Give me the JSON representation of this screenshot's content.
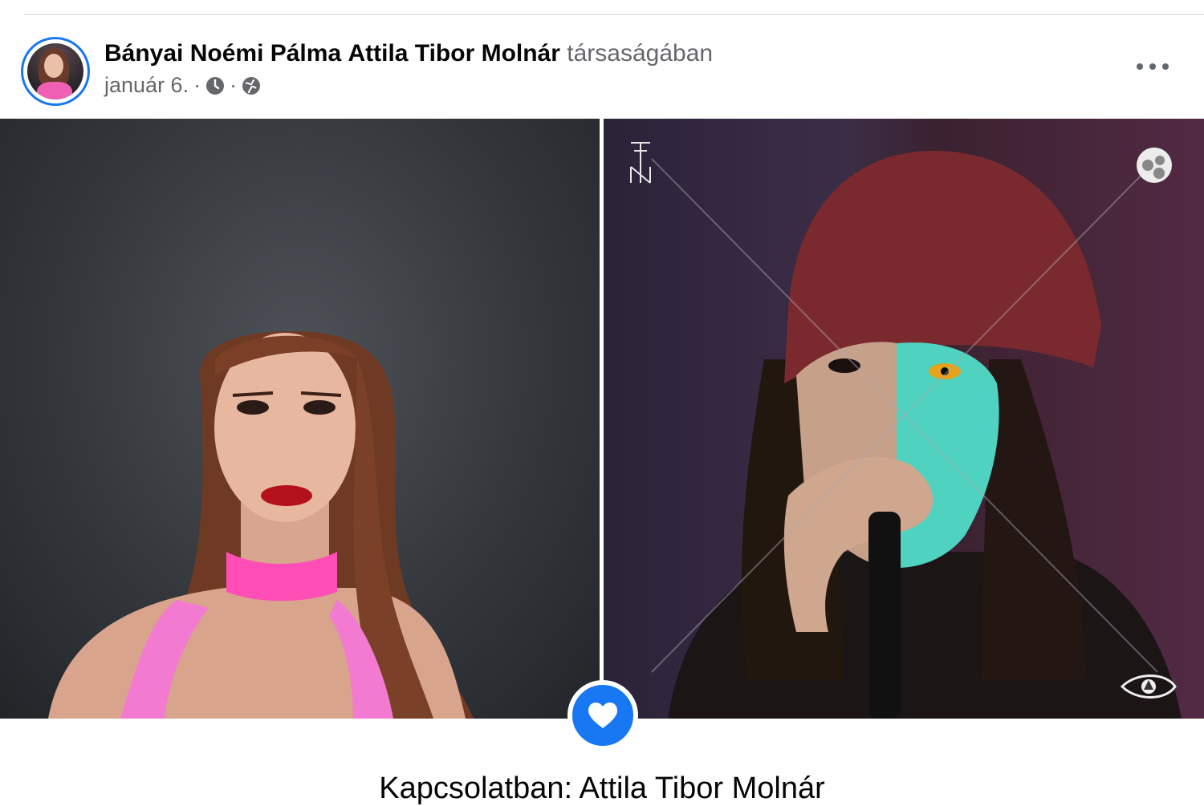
{
  "post": {
    "author": "Bányai Noémi Pálma",
    "tagged": "Attila Tibor Molnár",
    "with_text": "társaságában",
    "date": "január 6.",
    "separator": "·"
  },
  "icons": {
    "clock": "clock-icon",
    "globe": "globe-icon",
    "more": "more-options-icon",
    "heart": "heart-icon",
    "eye": "eye-logo-icon"
  },
  "life_event": {
    "text": "Kapcsolatban: Attila Tibor Molnár"
  },
  "colors": {
    "accent": "#1877f2",
    "secondary_text": "#65676b",
    "primary_text": "#050505"
  }
}
